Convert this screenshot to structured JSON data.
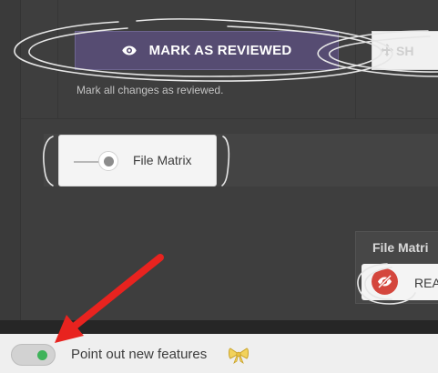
{
  "review": {
    "mark_label": "MARK AS REVIEWED",
    "show_label": "SH",
    "helper": "Mark all changes as reviewed."
  },
  "file_matrix_toggle": {
    "label": "File Matrix",
    "state": "off"
  },
  "file_matrix_panel": {
    "title": "File Matri",
    "read_label": "REA"
  },
  "footer": {
    "feature_label": "Point out new features",
    "toggle_state": "on"
  },
  "colors": {
    "accent_purple": "#564c72",
    "annotation_red": "#e8231f",
    "toggle_green": "#3fb35a",
    "read_red": "#d4463d"
  },
  "icons": {
    "mark": "eye-icon",
    "show": "move-icon",
    "read": "eye-slash-icon",
    "feature": "bow-icon"
  }
}
